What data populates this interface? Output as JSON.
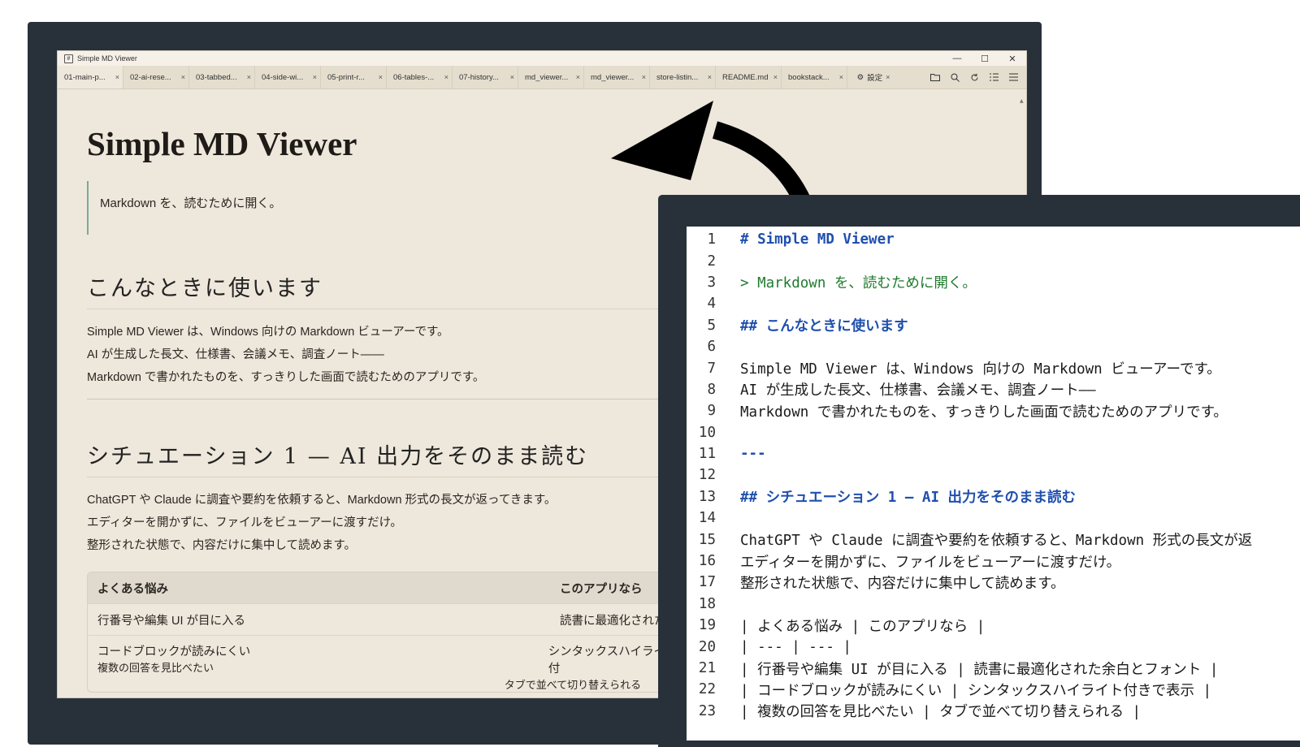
{
  "window": {
    "title": "Simple MD Viewer",
    "controls": [
      "—",
      "☐",
      "✕"
    ]
  },
  "tabs": [
    {
      "label": "01-main-p...",
      "active": true
    },
    {
      "label": "02-ai-rese...",
      "active": false
    },
    {
      "label": "03-tabbed...",
      "active": false
    },
    {
      "label": "04-side-wi...",
      "active": false
    },
    {
      "label": "05-print-r...",
      "active": false
    },
    {
      "label": "06-tables-...",
      "active": false
    },
    {
      "label": "07-history...",
      "active": false
    },
    {
      "label": "md_viewer...",
      "active": false
    },
    {
      "label": "md_viewer...",
      "active": false
    },
    {
      "label": "store-listin...",
      "active": false
    },
    {
      "label": "README.md",
      "active": false
    },
    {
      "label": "bookstack...",
      "active": false
    }
  ],
  "settings_tab": {
    "label": "設定"
  },
  "tab_close": "×",
  "toolbar_icons": [
    "folder-icon",
    "search-icon",
    "reload-icon",
    "outline-icon",
    "menu-icon"
  ],
  "document": {
    "title": "Simple MD Viewer",
    "quote": "Markdown を、読むために開く。",
    "h2_1": "こんなときに使います",
    "para1": [
      "Simple MD Viewer は、Windows 向けの Markdown ビューアーです。",
      "AI が生成した長文、仕様書、会議メモ、調査ノート——",
      "Markdown で書かれたものを、すっきりした画面で読むためのアプリです。"
    ],
    "h2_2": "シチュエーション 1 — AI 出力をそのまま読む",
    "para2": [
      "ChatGPT や Claude に調査や要約を依頼すると、Markdown 形式の長文が返ってきます。",
      "エディターを開かずに、ファイルをビューアーに渡すだけ。",
      "整形された状態で、内容だけに集中して読めます。"
    ],
    "table": {
      "headers": [
        "よくある悩み",
        "このアプリなら"
      ],
      "rows": [
        [
          "行番号や編集 UI が目に入る",
          "読書に最適化された余"
        ],
        [
          "コードブロックが読みにくい",
          "シンタックスハイライト付"
        ]
      ],
      "partial_row": [
        "複数の回答を見比べたい",
        "タブで並べて切り替えられる"
      ]
    }
  },
  "editor": {
    "lines": [
      {
        "n": "1",
        "t": "# Simple MD Viewer",
        "k": "h"
      },
      {
        "n": "2",
        "t": "",
        "k": ""
      },
      {
        "n": "3",
        "t": "> Markdown を、読むために開く。",
        "k": "q"
      },
      {
        "n": "4",
        "t": "",
        "k": ""
      },
      {
        "n": "5",
        "t": "## こんなときに使います",
        "k": "h"
      },
      {
        "n": "6",
        "t": "",
        "k": ""
      },
      {
        "n": "7",
        "t": "Simple MD Viewer は、Windows 向けの Markdown ビューアーです。",
        "k": ""
      },
      {
        "n": "8",
        "t": "AI が生成した長文、仕様書、会議メモ、調査ノート——",
        "k": ""
      },
      {
        "n": "9",
        "t": "Markdown で書かれたものを、すっきりした画面で読むためのアプリです。",
        "k": ""
      },
      {
        "n": "10",
        "t": "",
        "k": ""
      },
      {
        "n": "11",
        "t": "---",
        "k": "h"
      },
      {
        "n": "12",
        "t": "",
        "k": ""
      },
      {
        "n": "13",
        "t": "## シチュエーション 1 — AI 出力をそのまま読む",
        "k": "h"
      },
      {
        "n": "14",
        "t": "",
        "k": ""
      },
      {
        "n": "15",
        "t": "ChatGPT や Claude に調査や要約を依頼すると、Markdown 形式の長文が返",
        "k": ""
      },
      {
        "n": "16",
        "t": "エディターを開かずに、ファイルをビューアーに渡すだけ。",
        "k": ""
      },
      {
        "n": "17",
        "t": "整形された状態で、内容だけに集中して読めます。",
        "k": ""
      },
      {
        "n": "18",
        "t": "",
        "k": ""
      },
      {
        "n": "19",
        "t": "| よくある悩み | このアプリなら |",
        "k": ""
      },
      {
        "n": "20",
        "t": "| --- | --- |",
        "k": ""
      },
      {
        "n": "21",
        "t": "| 行番号や編集 UI が目に入る | 読書に最適化された余白とフォント |",
        "k": ""
      },
      {
        "n": "22",
        "t": "| コードブロックが読みにくい | シンタックスハイライト付きで表示 |",
        "k": ""
      },
      {
        "n": "23",
        "t": "| 複数の回答を見比べたい | タブで並べて切り替えられる |",
        "k": ""
      }
    ]
  },
  "colors": {
    "bezel": "#28313a",
    "paper": "#eee7db",
    "heading_code": "#1f4fae",
    "quote_code": "#1f7a2e",
    "quote_bar": "#7aa89a"
  }
}
